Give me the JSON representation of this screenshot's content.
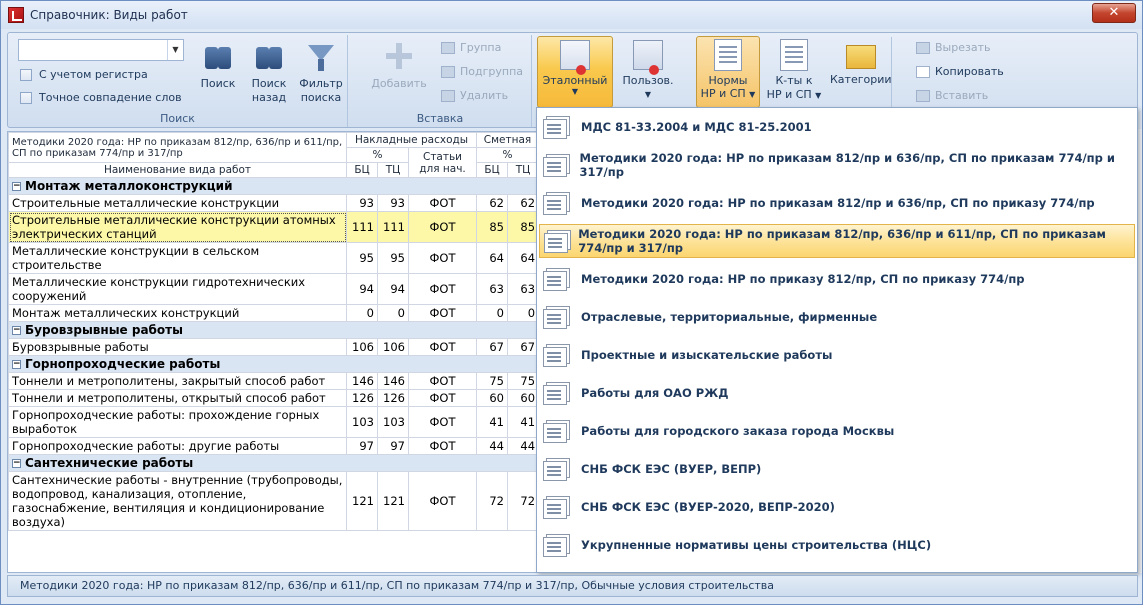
{
  "window": {
    "title": "Справочник: Виды работ",
    "close_label": "✕"
  },
  "ribbon": {
    "search_group": {
      "label": "Поиск",
      "combo_value": "",
      "case_sensitive_label": "С учетом регистра",
      "exact_match_label": "Точное совпадение слов",
      "search_label": "Поиск",
      "search_back_label_1": "Поиск",
      "search_back_label_2": "назад",
      "filter_label_1": "Фильтр",
      "filter_label_2": "поиска"
    },
    "insert_group": {
      "label": "Вставка",
      "add_label": "Добавить",
      "group_label": "Группа",
      "subgroup_label": "Подгруппа",
      "delete_label": "Удалить"
    },
    "etalon_label": "Эталонный",
    "user_label": "Пользов.",
    "norms_label_1": "Нормы",
    "norms_label_2": "НР и СП",
    "coef_label_1": "К-ты к",
    "coef_label_2": "НР и СП",
    "categories_label": "Категории",
    "cut_label": "Вырезать",
    "copy_label": "Копировать",
    "paste_label": "Вставить"
  },
  "grid": {
    "header_method": "Методики 2020 года: НР по приказам 812/пр, 636/пр и 611/пр, СП по приказам 774/пр и 317/пр",
    "header_overhead": "Накладные расходы",
    "header_profit": "Сметная",
    "header_percent": "%",
    "header_articles": "Статьи для нач.",
    "header_name": "Наименование вида работ",
    "header_bc": "БЦ",
    "header_tc": "ТЦ",
    "groups": [
      {
        "title": "Монтаж металлоконструкций",
        "toggle": "−",
        "rows": [
          {
            "name": "Строительные металлические конструкции",
            "bc": "93",
            "tc": "93",
            "art": "ФОТ",
            "bc2": "62",
            "tc2": "62"
          },
          {
            "name": "Строительные металлические конструкции атомных электрических станций",
            "bc": "111",
            "tc": "111",
            "art": "ФОТ",
            "bc2": "85",
            "tc2": "85"
          },
          {
            "name": "Металлические конструкции в сельском строительстве",
            "bc": "95",
            "tc": "95",
            "art": "ФОТ",
            "bc2": "64",
            "tc2": "64"
          },
          {
            "name": "Металлические конструкции гидротехнических сооружений",
            "bc": "94",
            "tc": "94",
            "art": "ФОТ",
            "bc2": "63",
            "tc2": "63"
          },
          {
            "name": "Монтаж металлических конструкций",
            "bc": "0",
            "tc": "0",
            "art": "ФОТ",
            "bc2": "0",
            "tc2": "0"
          }
        ]
      },
      {
        "title": "Буровзрывные работы",
        "toggle": "−",
        "rows": [
          {
            "name": "Буровзрывные работы",
            "bc": "106",
            "tc": "106",
            "art": "ФОТ",
            "bc2": "67",
            "tc2": "67"
          }
        ]
      },
      {
        "title": "Горнопроходческие работы",
        "toggle": "−",
        "rows": [
          {
            "name": "Тоннели и метрополитены, закрытый способ работ",
            "bc": "146",
            "tc": "146",
            "art": "ФОТ",
            "bc2": "75",
            "tc2": "75"
          },
          {
            "name": "Тоннели и метрополитены, открытый способ работ",
            "bc": "126",
            "tc": "126",
            "art": "ФОТ",
            "bc2": "60",
            "tc2": "60"
          },
          {
            "name": "Горнопроходческие работы: прохождение горных выработок",
            "bc": "103",
            "tc": "103",
            "art": "ФОТ",
            "bc2": "41",
            "tc2": "41"
          },
          {
            "name": "Горнопроходческие работы: другие работы",
            "bc": "97",
            "tc": "97",
            "art": "ФОТ",
            "bc2": "44",
            "tc2": "44"
          }
        ]
      },
      {
        "title": "Сантехнические работы",
        "toggle": "−",
        "rows": [
          {
            "name": "Сантехнические работы - внутренние (трубопроводы, водопровод, канализация, отопление, газоснабжение, вентиляция и кондиционирование воздуха)",
            "bc": "121",
            "tc": "121",
            "art": "ФОТ",
            "bc2": "72",
            "tc2": "72"
          }
        ]
      }
    ]
  },
  "dropdown": {
    "items": [
      "МДС 81-33.2004 и МДС 81-25.2001",
      "Методики 2020 года: НР по приказам 812/пр и 636/пр, СП по приказам 774/пр и 317/пр",
      "Методики 2020 года: НР по приказам 812/пр и 636/пр, СП по приказу 774/пр",
      "Методики 2020 года: НР по приказам 812/пр, 636/пр и 611/пр, СП по приказам 774/пр и 317/пр",
      "Методики 2020 года: НР по приказу 812/пр, СП по приказу 774/пр",
      "Отраслевые, территориальные, фирменные",
      "Проектные и изыскательские работы",
      "Работы для ОАО РЖД",
      "Работы для городского заказа города Москвы",
      "СНБ ФСК ЕЭС (ВУЕР, ВЕПР)",
      "СНБ ФСК ЕЭС (ВУЕР-2020, ВЕПР-2020)",
      "Укрупненные нормативы цены строительства (НЦС)"
    ],
    "active_index": 3
  },
  "status": "Методики 2020 года: НР по приказам 812/пр, 636/пр и 611/пр, СП по приказам 774/пр и 317/пр, Обычные условия строительства"
}
